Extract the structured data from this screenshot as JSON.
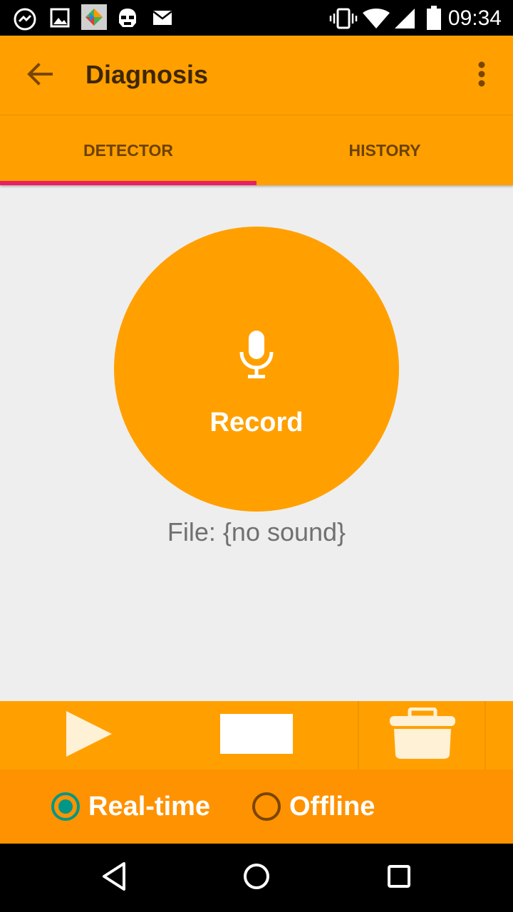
{
  "status_bar": {
    "time": "09:34",
    "icons": [
      "messenger-icon",
      "gallery-icon",
      "app-store-icon",
      "stormtrooper-icon",
      "mail-icon",
      "vibrate-icon",
      "wifi-icon",
      "signal-icon",
      "battery-icon"
    ]
  },
  "app_bar": {
    "title": "Diagnosis",
    "back_icon": "arrow-back-icon",
    "menu_icon": "more-vert-icon"
  },
  "tabs": [
    {
      "label": "DETECTOR",
      "selected": true
    },
    {
      "label": "HISTORY",
      "selected": false
    }
  ],
  "record": {
    "label": "Record",
    "icon": "microphone-icon"
  },
  "file_status": "File: {no sound}",
  "controls": {
    "icons": [
      "play-icon",
      "stop-icon",
      "delete-icon"
    ]
  },
  "mode": {
    "options": [
      {
        "label": "Real-time",
        "checked": true
      },
      {
        "label": "Offline",
        "checked": false
      }
    ]
  },
  "colors": {
    "primary": "#ffa000",
    "accent": "#e91e63",
    "radio_checked": "#009688"
  }
}
